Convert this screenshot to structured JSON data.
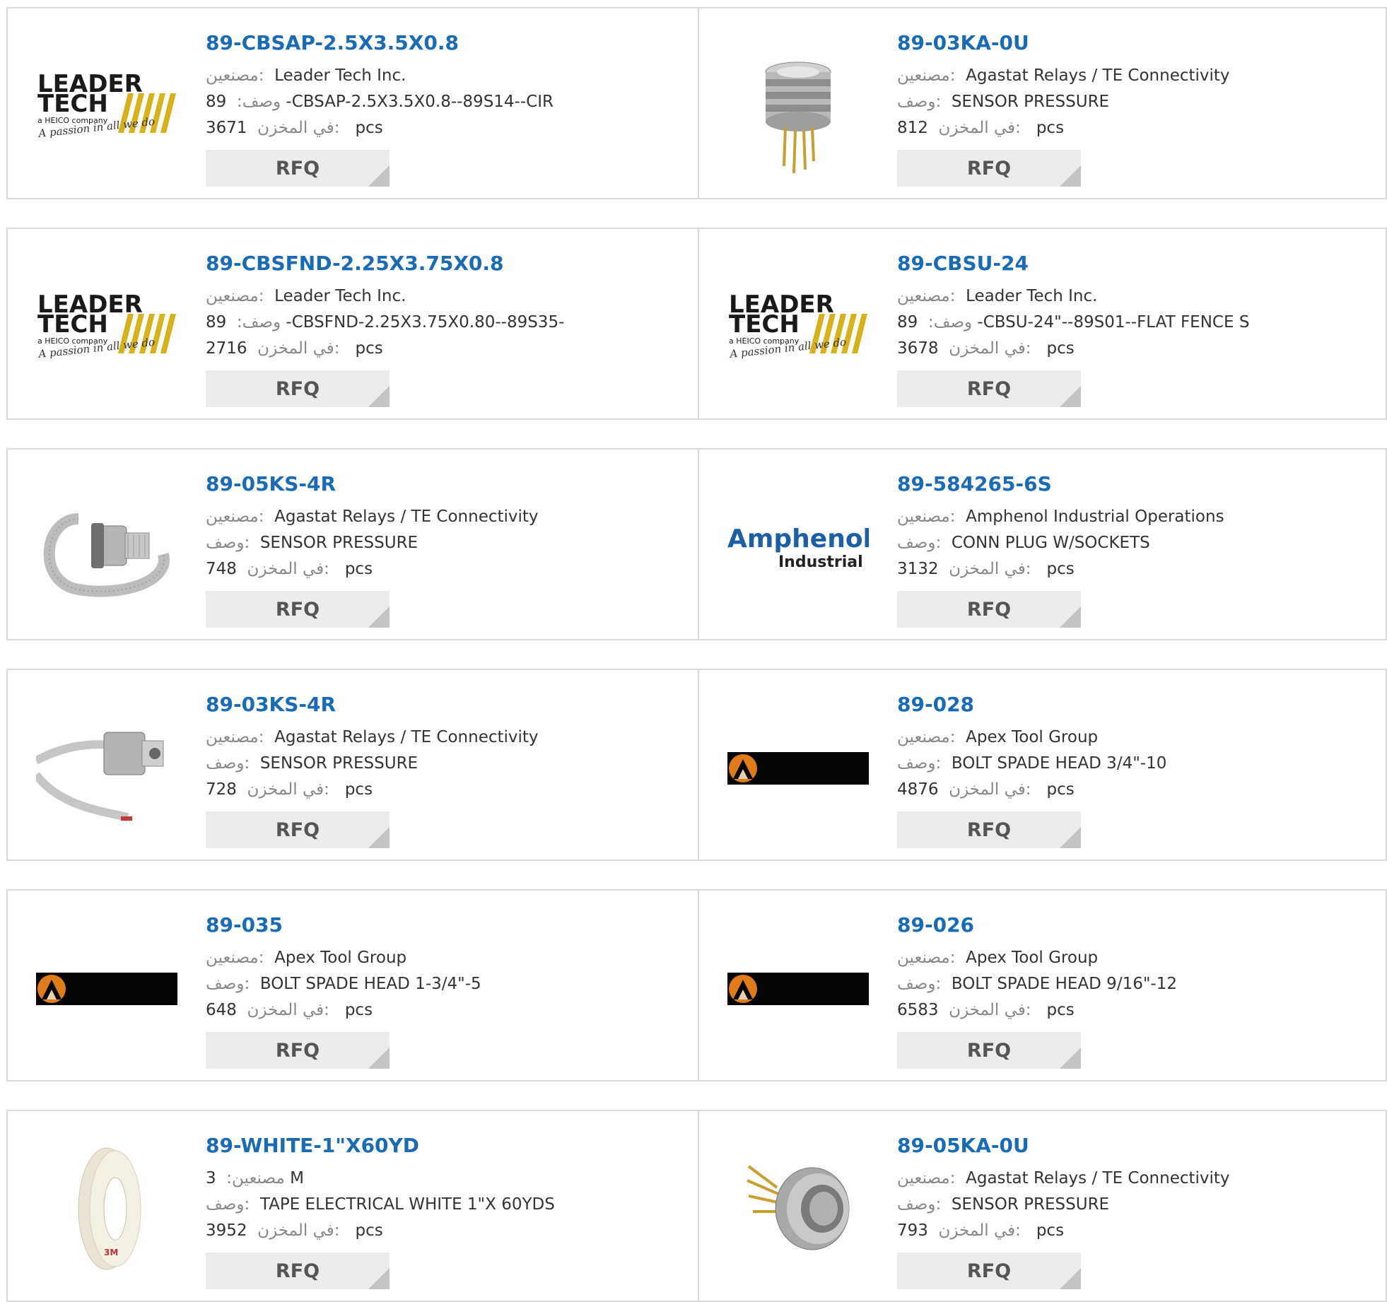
{
  "labels": {
    "manufacturer": "مصنعين:",
    "description": "وصف:",
    "stock": "في المخزن:",
    "unit": "pcs",
    "rfq": "RFQ"
  },
  "logos": {
    "leadertech": {
      "line1": "LEADER",
      "line2": "TECH",
      "tag": "a HEICO company",
      "slogan": "A passion in all we do"
    },
    "amphenol": {
      "name": "Amphenol",
      "reg": "®",
      "sub": "Industrial"
    },
    "tape": {
      "brand": "3M"
    }
  },
  "products": [
    {
      "part": "89-CBSAP-2.5X3.5X0.8",
      "manufacturer": "Leader Tech Inc.",
      "description": "89 -CBSAP-2.5X3.5X0.8--89S14--CIR",
      "stock": "3671",
      "image": "leadertech-logo"
    },
    {
      "part": "89-03KA-0U",
      "manufacturer": "Agastat Relays / TE Connectivity",
      "description": "SENSOR PRESSURE",
      "stock": "812",
      "image": "pressure-sensor-can"
    },
    {
      "part": "89-CBSFND-2.25X3.75X0.8",
      "manufacturer": "Leader Tech Inc.",
      "description": "89 -CBSFND-2.25X3.75X0.80--89S35-",
      "stock": "2716",
      "image": "leadertech-logo"
    },
    {
      "part": "89-CBSU-24",
      "manufacturer": "Leader Tech Inc.",
      "description": "89 -CBSU-24\"--89S01--FLAT FENCE S",
      "stock": "3678",
      "image": "leadertech-logo"
    },
    {
      "part": "89-05KS-4R",
      "manufacturer": "Agastat Relays / TE Connectivity",
      "description": "SENSOR PRESSURE",
      "stock": "748",
      "image": "sensor-with-ribbon"
    },
    {
      "part": "89-584265-6S",
      "manufacturer": "Amphenol Industrial Operations",
      "description": "CONN PLUG W/SOCKETS",
      "stock": "3132",
      "image": "amphenol-logo"
    },
    {
      "part": "89-03KS-4R",
      "manufacturer": "Agastat Relays / TE Connectivity",
      "description": "SENSOR PRESSURE",
      "stock": "728",
      "image": "sensor-with-cable"
    },
    {
      "part": "89-028",
      "manufacturer": "Apex Tool Group",
      "description": "BOLT SPADE HEAD 3/4\"-10",
      "stock": "4876",
      "image": "apex-logo"
    },
    {
      "part": "89-035",
      "manufacturer": "Apex Tool Group",
      "description": "BOLT SPADE HEAD 1-3/4\"-5",
      "stock": "648",
      "image": "apex-logo"
    },
    {
      "part": "89-026",
      "manufacturer": "Apex Tool Group",
      "description": "BOLT SPADE HEAD 9/16\"-12",
      "stock": "6583",
      "image": "apex-logo"
    },
    {
      "part": "89-WHITE-1\"X60YD",
      "manufacturer": "3 M",
      "description": "TAPE ELECTRICAL WHITE 1\"X 60YDS",
      "stock": "3952",
      "image": "tape-roll"
    },
    {
      "part": "89-05KA-0U",
      "manufacturer": "Agastat Relays / TE Connectivity",
      "description": "SENSOR PRESSURE",
      "stock": "793",
      "image": "pressure-sensor-pins"
    }
  ],
  "colors": {
    "link": "#1a6bb5",
    "border": "#d9d9d9",
    "button": "#ececec",
    "apex_orange": "#e07b1a"
  }
}
